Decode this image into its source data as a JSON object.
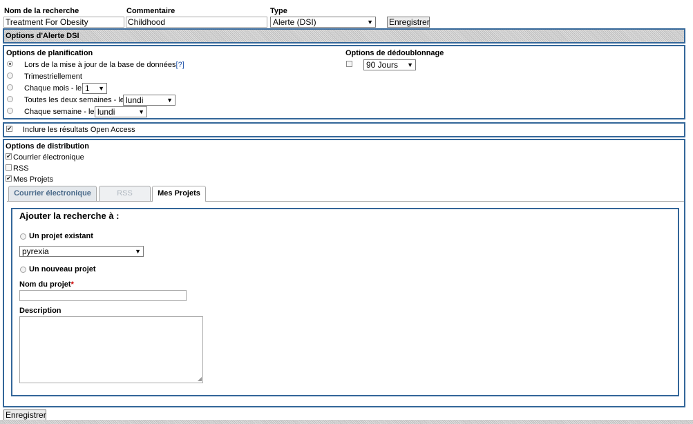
{
  "top": {
    "search_name_label": "Nom de la recherche",
    "search_name_value": "Treatment For Obesity",
    "comment_label": "Commentaire",
    "comment_value": "Childhood",
    "type_label": "Type",
    "type_value": "Alerte (DSI)",
    "save_label": "Enregistrer"
  },
  "alert_options_header": "Options d'Alerte DSI",
  "planning": {
    "title": "Options de planification",
    "options": [
      {
        "label": "Lors de la mise à jour de la base de données",
        "help": "[?]",
        "checked": true
      },
      {
        "label": "Trimestriellement",
        "checked": false
      },
      {
        "label": "Chaque mois - le",
        "select": "1",
        "checked": false
      },
      {
        "label": "Toutes les deux semaines - le",
        "select": "lundi",
        "checked": false
      },
      {
        "label": "Chaque semaine - le",
        "select": "lundi",
        "checked": false
      }
    ]
  },
  "dedup": {
    "title": "Options de dédoublonnage",
    "checked": false,
    "select": "90 Jours"
  },
  "open_access": {
    "label": "Inclure les résultats Open Access",
    "checked": true
  },
  "distribution": {
    "title": "Options de distribution",
    "email_label": "Courrier électronique",
    "rss_label": "RSS",
    "projects_label": "Mes Projets"
  },
  "tabs": {
    "email": "Courrier électronique",
    "rss": "RSS",
    "projects": "Mes Projets"
  },
  "projects_panel": {
    "title": "Ajouter la recherche à :",
    "existing_label": "Un projet existant",
    "existing_value": "pyrexia",
    "new_label": "Un nouveau projet",
    "name_label": "Nom du projet",
    "required_mark": "*",
    "description_label": "Description"
  },
  "bottom_save_label": "Enregistrer"
}
